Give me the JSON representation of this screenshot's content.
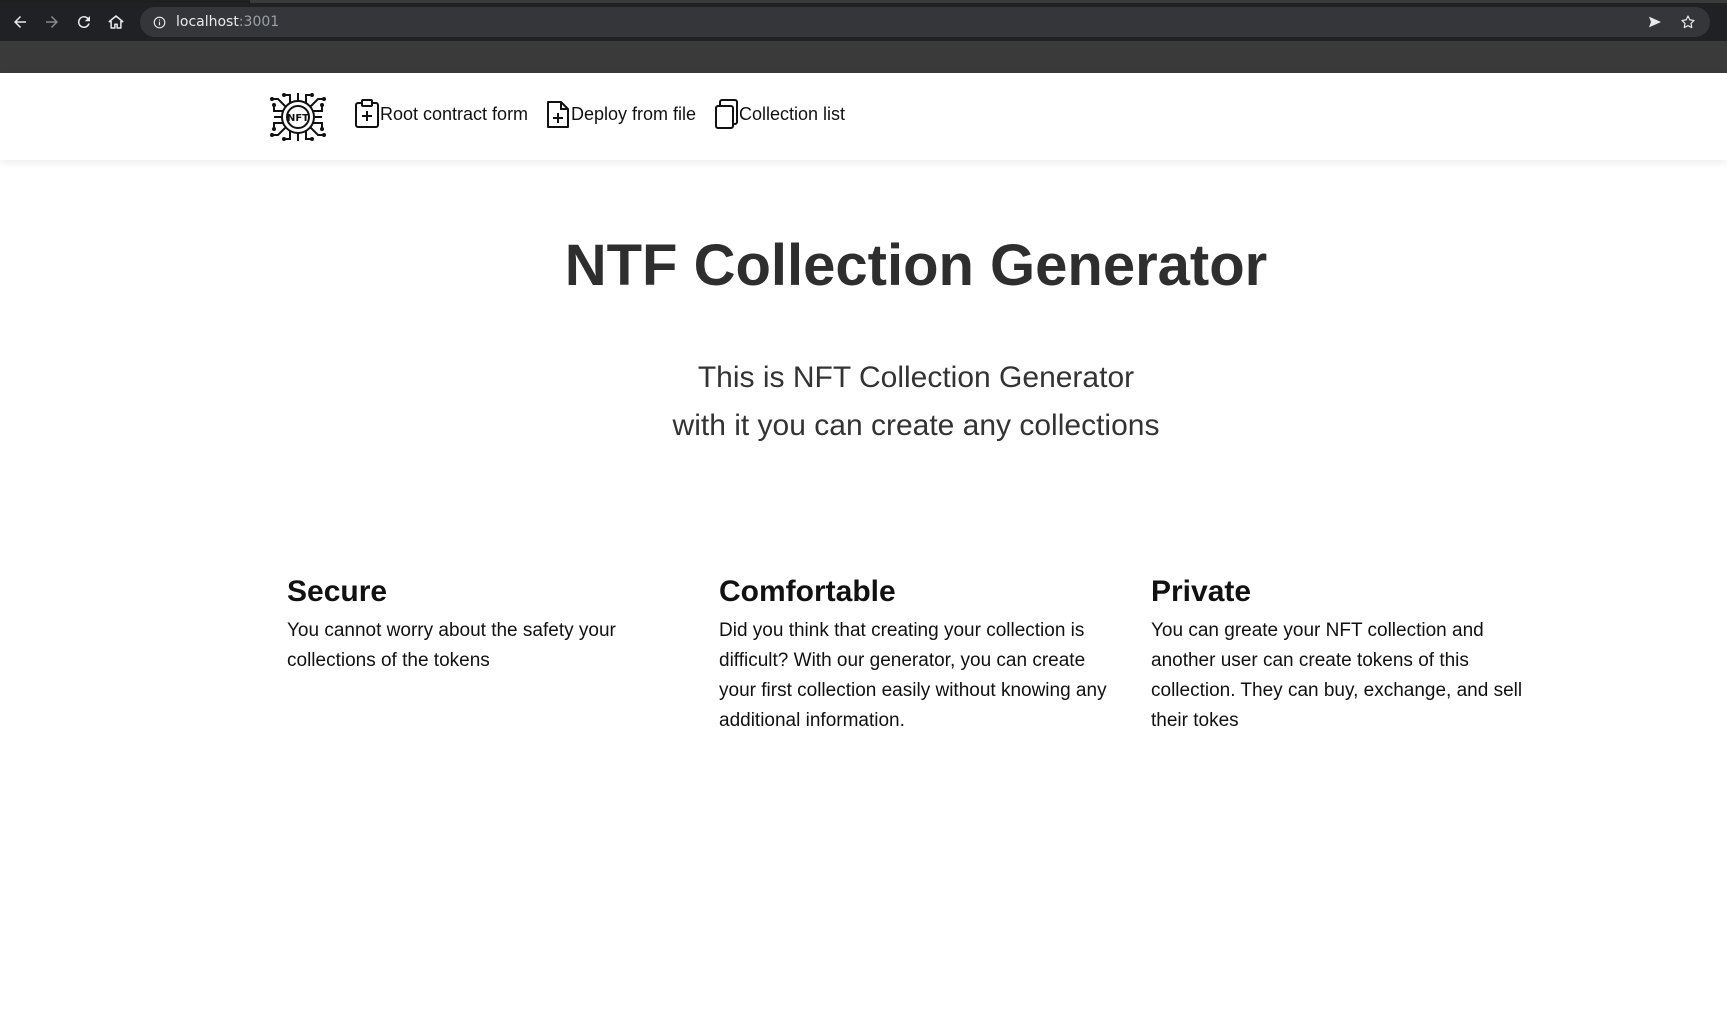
{
  "browser": {
    "url_host": "localhost",
    "url_port": ":3001",
    "icons": {
      "back": "arrow-left-icon",
      "forward": "arrow-right-icon",
      "reload": "reload-icon",
      "home": "home-icon",
      "info": "info-icon",
      "send": "send-icon",
      "bookmark": "star-icon"
    }
  },
  "navbar": {
    "logo_icon": "nft-logo-icon",
    "links": [
      {
        "label": "Root contract form",
        "icon": "clipboard-plus-icon"
      },
      {
        "label": "Deploy from file",
        "icon": "file-plus-icon"
      },
      {
        "label": "Collection list",
        "icon": "copy-icon"
      }
    ]
  },
  "hero": {
    "title": "NTF Collection Generator",
    "subtitle_line1": "This is NFT Collection Generator",
    "subtitle_line2": "with it you can create any collections"
  },
  "features": [
    {
      "title": "Secure",
      "text": "You cannot worry about the safety your collections of the tokens"
    },
    {
      "title": "Comfortable",
      "text": "Did you think that creating your collection is difficult? With our generator, you can create your first collection easily without knowing any additional information."
    },
    {
      "title": "Private",
      "text": "You can greate your NFT collection and another user can create tokens of this collection. They can buy, exchange, and sell their tokes"
    }
  ],
  "colors": {
    "chrome_bg": "#202124",
    "omnibox_bg": "#35363a",
    "title_text": "#2e2e2e"
  }
}
